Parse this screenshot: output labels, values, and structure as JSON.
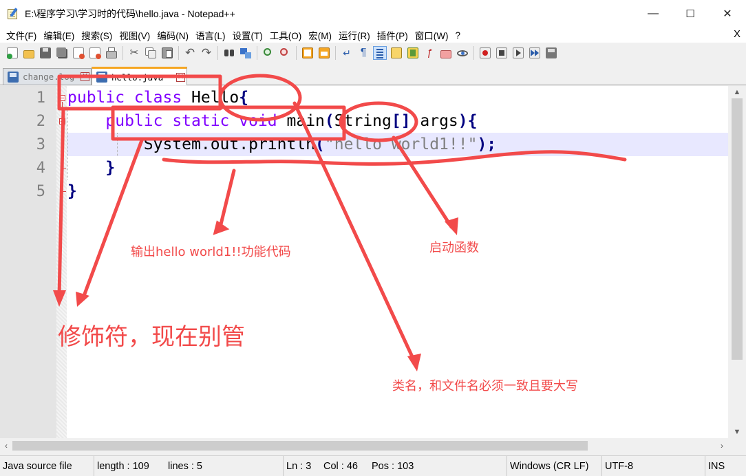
{
  "window": {
    "title": "E:\\程序学习\\学习时的代码\\hello.java - Notepad++",
    "minimize": "—",
    "maximize": "☐",
    "close": "✕"
  },
  "menu": {
    "items": [
      "文件(F)",
      "编辑(E)",
      "搜索(S)",
      "视图(V)",
      "编码(N)",
      "语言(L)",
      "设置(T)",
      "工具(O)",
      "宏(M)",
      "运行(R)",
      "插件(P)",
      "窗口(W)",
      "?"
    ],
    "close": "X"
  },
  "tabs": [
    {
      "label": "change.log",
      "active": false
    },
    {
      "label": "hello.java",
      "active": true
    }
  ],
  "editor": {
    "line_numbers": [
      "1",
      "2",
      "3",
      "4",
      "5"
    ],
    "line1": {
      "kw": "public class ",
      "name": "Hello",
      "brace": "{"
    },
    "line2": {
      "indent": "    ",
      "kw": "public static void ",
      "name": "main",
      "paren": "(",
      "type": "String",
      "brackets": "[] ",
      "arg": "args",
      "close": "){"
    },
    "line3": {
      "indent": "        ",
      "call": "System.out.println",
      "paren": "(",
      "str": "\"hello world1!!\"",
      "close": ");"
    },
    "line4": {
      "indent": "    ",
      "brace": "}"
    },
    "line5": {
      "brace": "}"
    }
  },
  "statusbar": {
    "filetype": "Java source file",
    "length": "length : 109",
    "lines": "lines : 5",
    "ln": "Ln : 3",
    "col": "Col : 46",
    "pos": "Pos : 103",
    "eol": "Windows (CR LF)",
    "encoding": "UTF-8",
    "ins": "INS"
  },
  "annotations": {
    "color": "#f24a4a",
    "output_code": "输出hello world1!!功能代码",
    "main_func": "启动函数",
    "modifier": "修饰符，现在别管",
    "class_name": "类名，和文件名必须一致且要大写"
  },
  "colors": {
    "keyword": "#8000ff",
    "string": "#808080",
    "operator": "#000080",
    "current_line": "#e8e8ff",
    "annotation": "#f24a4a"
  }
}
